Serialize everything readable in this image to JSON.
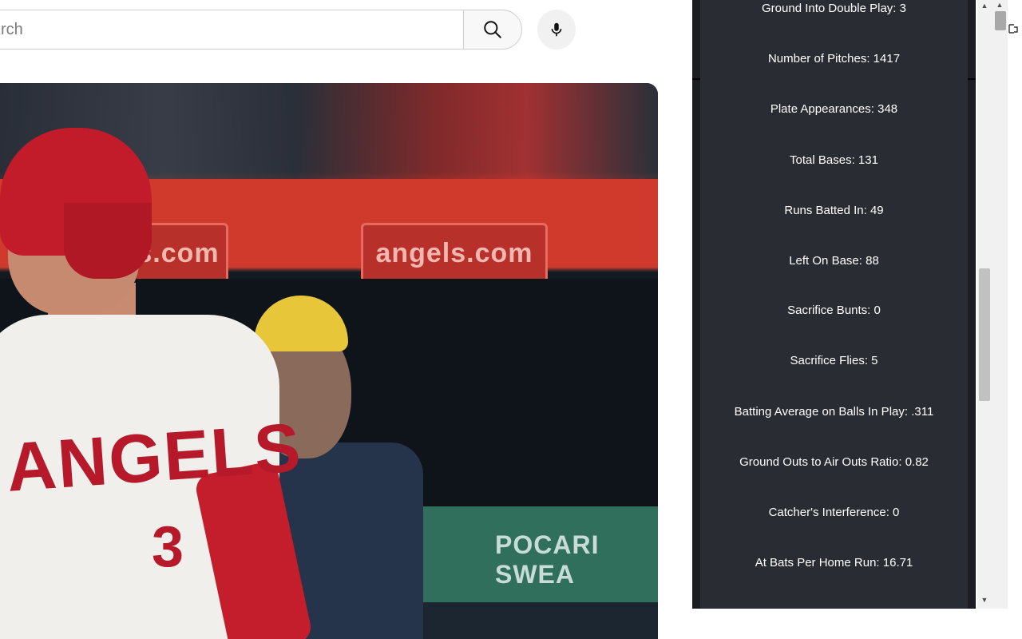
{
  "search": {
    "placeholder": "rch"
  },
  "video": {
    "banner_left": "s.com",
    "banner_main": "angels.com",
    "jersey_text": "ANGELS",
    "jersey_number": "3",
    "rail_text": "POCARI SWEA"
  },
  "stats": [
    {
      "label": "Ground Into Double Play",
      "value": "3"
    },
    {
      "label": "Number of Pitches",
      "value": "1417"
    },
    {
      "label": "Plate Appearances",
      "value": "348"
    },
    {
      "label": "Total Bases",
      "value": "131"
    },
    {
      "label": "Runs Batted In",
      "value": "49"
    },
    {
      "label": "Left On Base",
      "value": "88"
    },
    {
      "label": "Sacrifice Bunts",
      "value": "0"
    },
    {
      "label": "Sacrifice Flies",
      "value": "5"
    },
    {
      "label": "Batting Average on Balls In Play",
      "value": ".311"
    },
    {
      "label": "Ground Outs to Air Outs Ratio",
      "value": "0.82"
    },
    {
      "label": "Catcher's Interference",
      "value": "0"
    },
    {
      "label": "At Bats Per Home Run",
      "value": "16.71"
    }
  ],
  "icons": {
    "search": "search-icon",
    "mic": "microphone-icon",
    "scroll_up": "▲",
    "scroll_down": "▼"
  },
  "colors": {
    "popup_bg": "#2a2c33",
    "popup_frame": "#1b1d23",
    "stat_text": "#ffffff"
  }
}
